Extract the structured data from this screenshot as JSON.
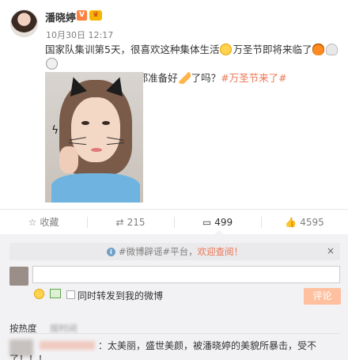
{
  "post": {
    "username": "潘晓婷",
    "vip_badge": "V",
    "member_badge": "♛",
    "timestamp": "10月30日 12:17",
    "text_part1": "国家队集训第5天，很喜欢这种集体生活",
    "text_part2": "万圣节即将来临了",
    "text_part3": "Trick or Treat！你们都准备好",
    "text_part4": "了吗？",
    "hashtag": "#万圣节来了#"
  },
  "actions": [
    {
      "label": "收藏",
      "icon": "star-icon",
      "glyph": "☆"
    },
    {
      "label": "215",
      "icon": "repost-icon",
      "glyph": "⇄"
    },
    {
      "label": "499",
      "icon": "comment-icon",
      "glyph": "▭"
    },
    {
      "label": "4595",
      "icon": "like-icon",
      "glyph": "👍"
    }
  ],
  "comments": {
    "notice_prefix": "#微博辟谣#平台，",
    "notice_link": "欢迎查阅！",
    "notice_close": "×",
    "info_glyph": "i",
    "input_placeholder": "",
    "repost_label": "同时转发到我的微博",
    "submit_label": "评论",
    "sort_hot": "按热度",
    "sort_time": "按时间",
    "first_comment_line1": "：太美丽，盛世美颜，被潘晓婷的美貌所暴击，受不",
    "first_comment_line2": "了！！！"
  },
  "colors": {
    "accent": "#eb7350",
    "submit_disabled": "#ffc09f",
    "panel_bg": "#f2f2f5"
  }
}
